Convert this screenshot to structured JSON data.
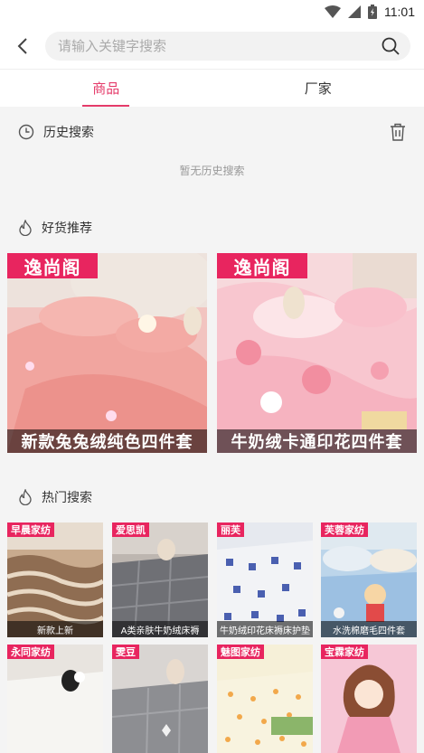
{
  "status_bar": {
    "time": "11:01"
  },
  "search": {
    "placeholder": "请输入关键字搜索"
  },
  "tabs": [
    {
      "label": "商品",
      "active": true
    },
    {
      "label": "厂家",
      "active": false
    }
  ],
  "history": {
    "title": "历史搜索",
    "empty_text": "暂无历史搜索"
  },
  "recommend": {
    "title": "好货推荐",
    "items": [
      {
        "brand": "逸尚阁",
        "caption": "新款兔兔绒纯色四件套"
      },
      {
        "brand": "逸尚阁",
        "caption": "牛奶绒卡通印花四件套"
      }
    ]
  },
  "hot": {
    "title": "热门搜索",
    "items": [
      {
        "brand": "早晨家纺",
        "caption": "新款上新"
      },
      {
        "brand": "爱思凯",
        "caption": "A类亲肤牛奶绒床褥"
      },
      {
        "brand": "丽芙",
        "caption": "牛奶绒印花床褥床护垫"
      },
      {
        "brand": "芙蓉家纺",
        "caption": "水洗棉磨毛四件套"
      },
      {
        "brand": "永同家纺",
        "caption": ""
      },
      {
        "brand": "雯豆",
        "caption": ""
      },
      {
        "brand": "魅图家纺",
        "caption": ""
      },
      {
        "brand": "宝霖家纺",
        "caption": ""
      }
    ]
  },
  "colors": {
    "accent": "#e53b6a",
    "brand_tag": "#e8255f"
  }
}
